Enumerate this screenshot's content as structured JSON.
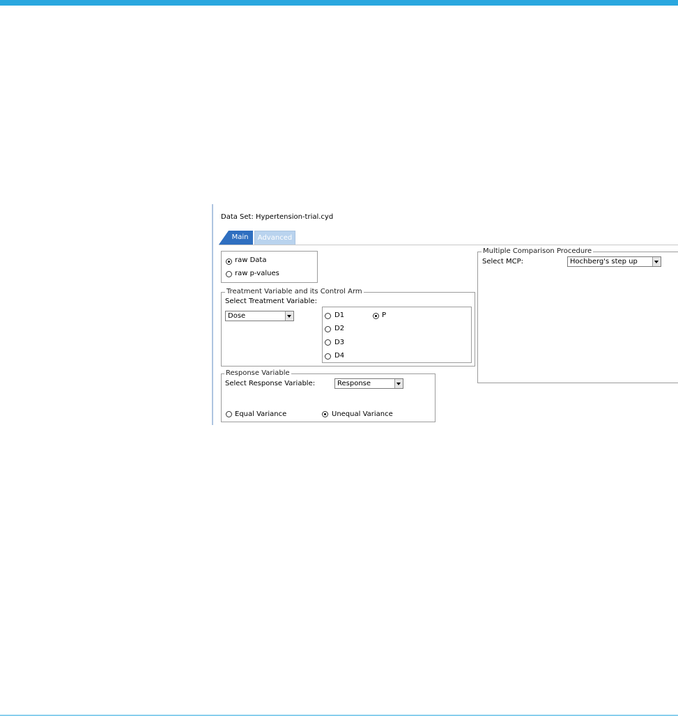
{
  "dataset": {
    "label": "Data Set: Hypertension-trial.cyd"
  },
  "tabs": [
    {
      "label": "Main",
      "active": true
    },
    {
      "label": "Advanced",
      "active": false
    }
  ],
  "input_type": {
    "options": [
      {
        "label": "raw Data",
        "checked": true
      },
      {
        "label": "raw p-values",
        "checked": false
      }
    ]
  },
  "treatment": {
    "legend": "Treatment Variable and its Control Arm",
    "select_label": "Select Treatment Variable:",
    "select_value": "Dose",
    "levels": [
      {
        "label": "D1",
        "checked": false
      },
      {
        "label": "P",
        "checked": true
      },
      {
        "label": "D2",
        "checked": false
      },
      {
        "label": "D3",
        "checked": false
      },
      {
        "label": "D4",
        "checked": false
      }
    ]
  },
  "response": {
    "legend": "Response Variable",
    "select_label": "Select Response Variable:",
    "select_value": "Response",
    "variance": [
      {
        "label": "Equal Variance",
        "checked": false
      },
      {
        "label": "Unequal Variance",
        "checked": true
      }
    ]
  },
  "mcp": {
    "legend": "Multiple Comparison Procedure",
    "select_label": "Select MCP:",
    "select_value": "Hochberg's step up"
  },
  "colors": {
    "accent": "#2aa7df",
    "tab_active": "#2f6fc0",
    "tab_inactive": "#b9d3ee"
  }
}
